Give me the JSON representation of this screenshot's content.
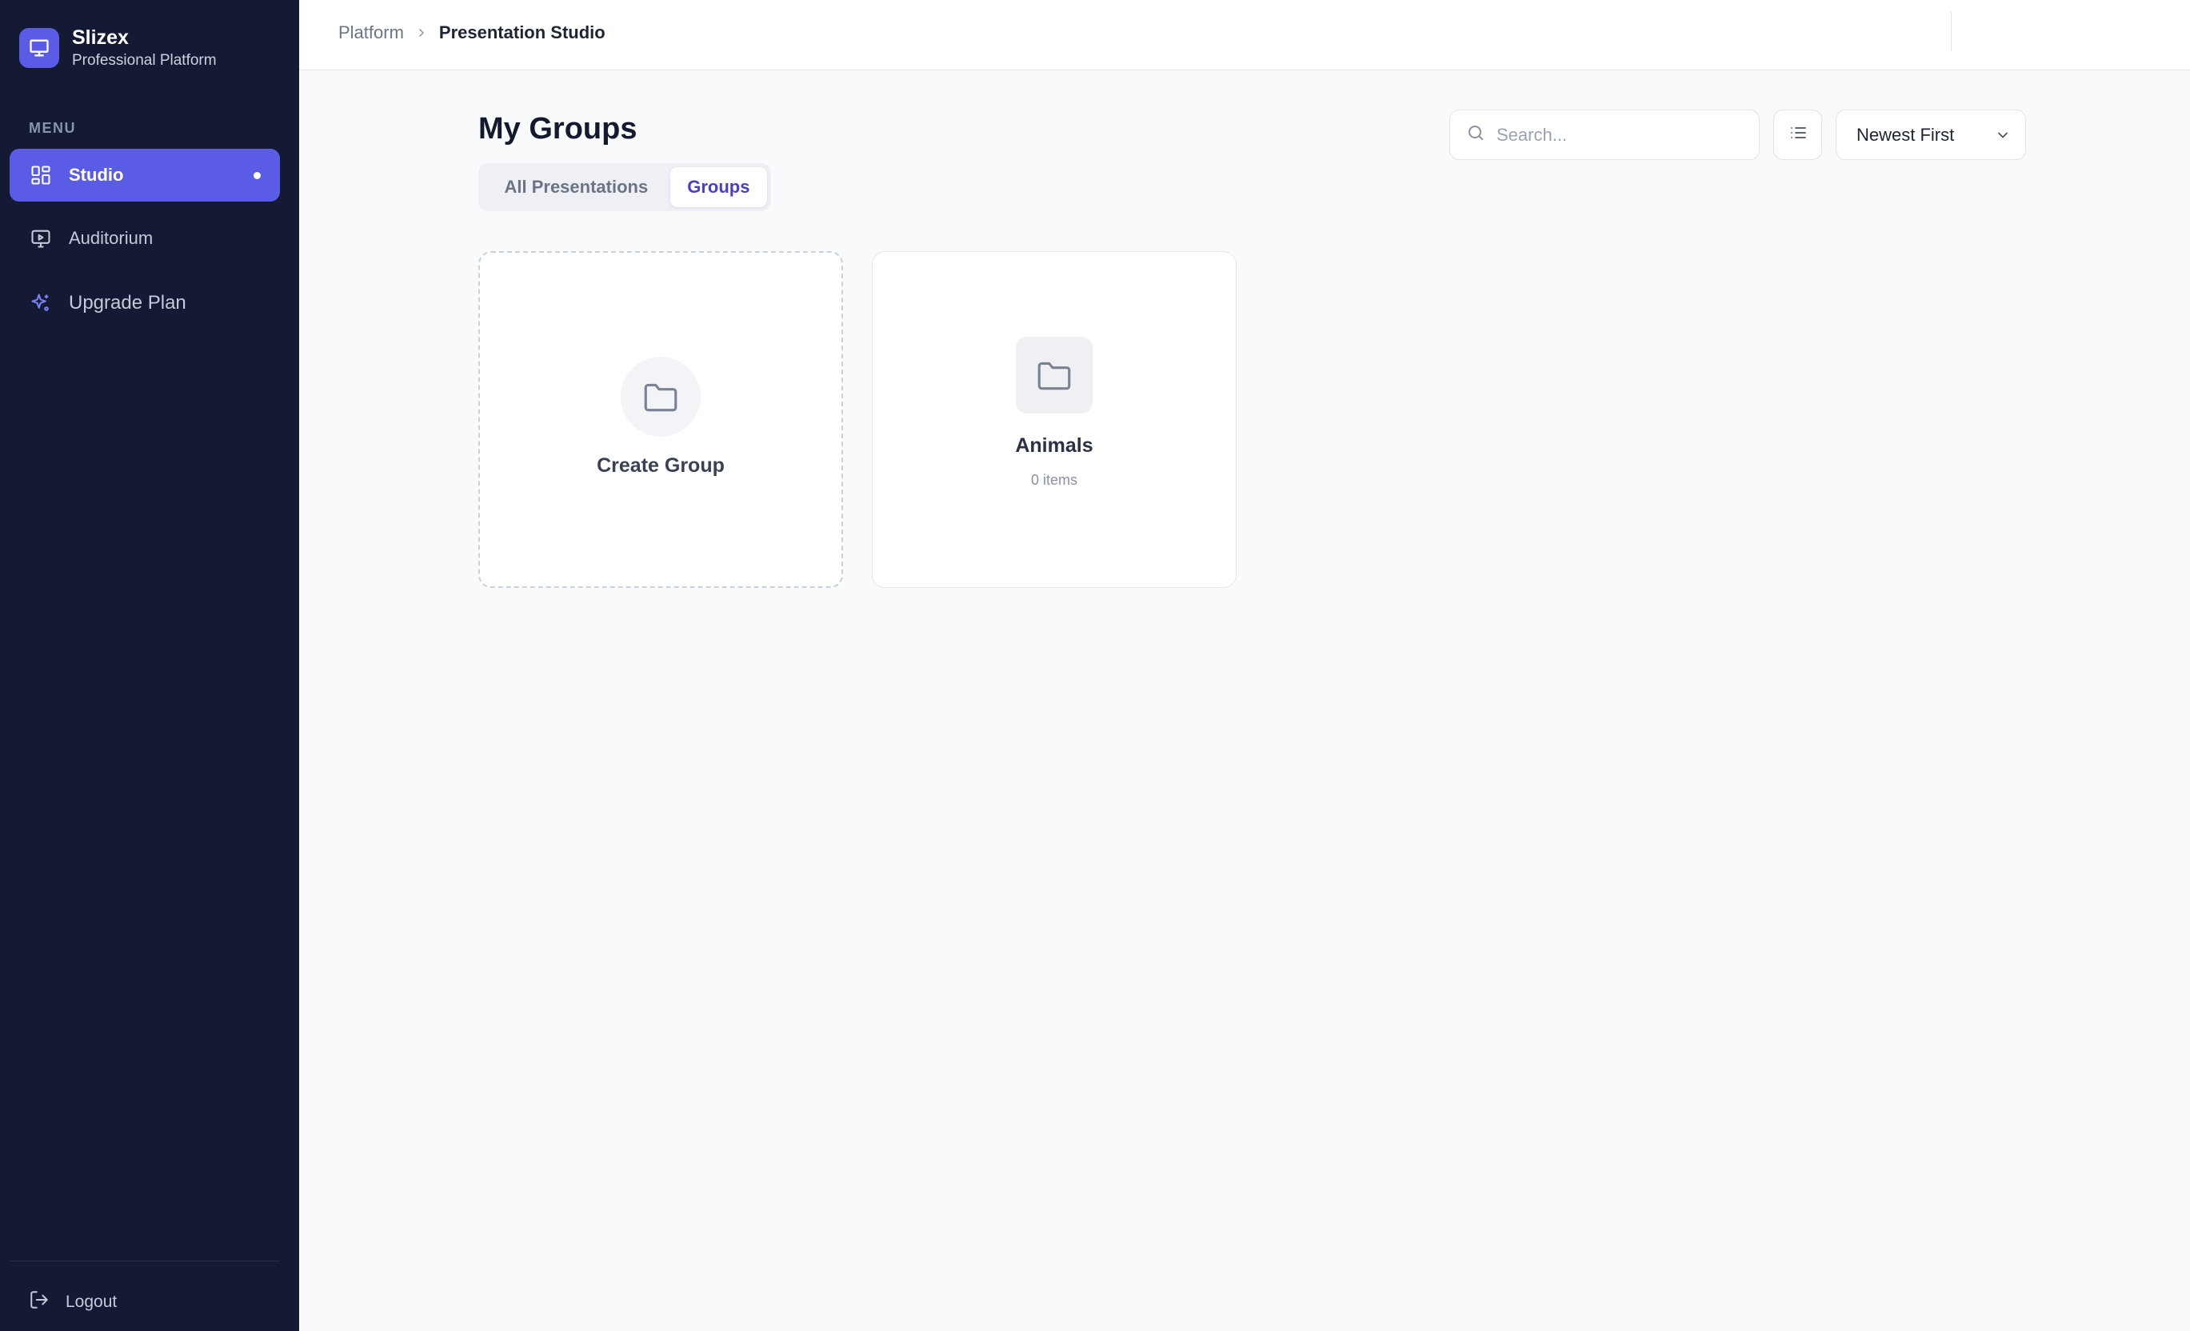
{
  "brand": {
    "name": "Slizex",
    "subtitle": "Professional Platform",
    "logo_icon": "presentation-icon",
    "accent_color": "#5b5ce6"
  },
  "sidebar": {
    "menu_label": "MENU",
    "items": [
      {
        "label": "Studio",
        "icon": "grid-icon",
        "active": true
      },
      {
        "label": "Auditorium",
        "icon": "monitor-play-icon",
        "active": false
      },
      {
        "label": "Upgrade Plan",
        "icon": "sparkles-icon",
        "active": false
      }
    ],
    "logout_label": "Logout",
    "background_color": "#141a33"
  },
  "breadcrumb": {
    "root": "Platform",
    "current": "Presentation Studio"
  },
  "main": {
    "title": "My Groups",
    "tabs": [
      {
        "label": "All Presentations",
        "active": false
      },
      {
        "label": "Groups",
        "active": true
      }
    ],
    "search": {
      "placeholder": "Search...",
      "value": ""
    },
    "sort": {
      "selected": "Newest First"
    },
    "create_card": {
      "label": "Create Group"
    },
    "groups": [
      {
        "name": "Animals",
        "count_label": "0 items"
      }
    ]
  }
}
